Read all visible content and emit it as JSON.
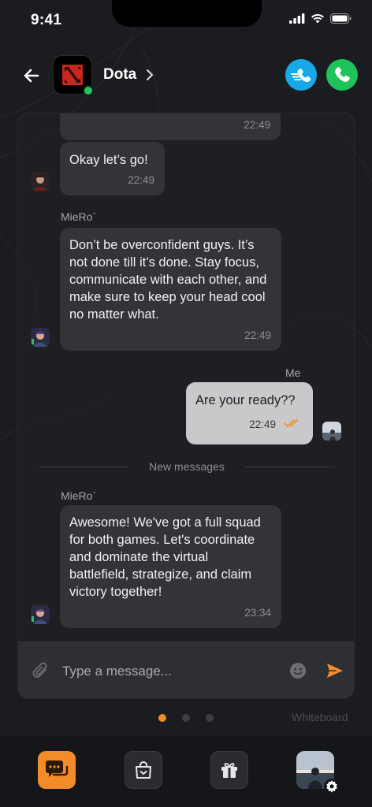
{
  "status_bar": {
    "time": "9:41"
  },
  "header": {
    "title": "Dota"
  },
  "messages": [
    {
      "time": "22:49"
    },
    {
      "text": "Okay let’s go!",
      "time": "22:49"
    },
    {
      "sender": "MieRo`",
      "text": "Don’t be overconfident guys. It’s not done till it’s done. Stay focus, communicate with each other, and make sure to keep your head cool no matter what.",
      "time": "22:49"
    },
    {
      "sender": "Me",
      "text": "Are your ready??",
      "time": "22:49"
    },
    {
      "sender": "MieRo`",
      "text": "Awesome! We've got a full squad for both games. Let's coordinate and dominate the virtual battlefield, strategize, and claim victory together!",
      "time": "23:34"
    }
  ],
  "divider_label": "New messages",
  "composer": {
    "placeholder": "Type a message..."
  },
  "pager": {
    "pages": 3,
    "active": 1,
    "right_label": "Whiteboard"
  },
  "icons": {
    "back": "arrow-left-icon",
    "video_call": "fast-call-icon",
    "call": "phone-icon",
    "attach": "paperclip-icon",
    "emoji": "emoji-icon",
    "send": "send-icon",
    "nav": [
      "chat-icon",
      "shopping-bag-icon",
      "gift-icon",
      "profile-avatar"
    ]
  },
  "colors": {
    "accent": "#f28c28",
    "video_call": "#18a8e8",
    "call": "#1fc35b",
    "online": "#22c55e",
    "background": "#1b1c20"
  }
}
